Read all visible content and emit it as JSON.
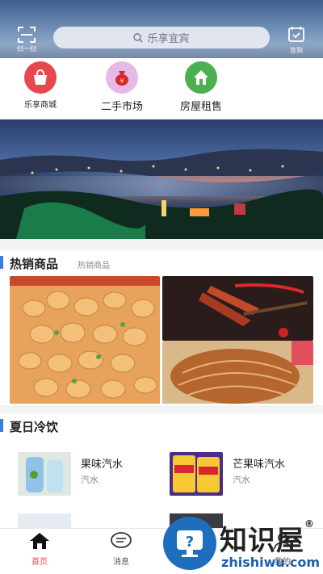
{
  "header": {
    "scan_label": "扫一扫",
    "search_placeholder": "乐享宜宾",
    "checkin_label": "签到"
  },
  "topnav": {
    "items": [
      {
        "label": "乐享商城",
        "icon": "shopping-bag-icon",
        "color": "#e8474d"
      },
      {
        "label": "二手市场",
        "icon": "money-bag-icon",
        "color": "#e6b9e6"
      },
      {
        "label": "房屋租售",
        "icon": "house-icon",
        "color": "#4caf50"
      }
    ]
  },
  "hot": {
    "title": "热销商品",
    "subtitle": "热销商品"
  },
  "summer": {
    "title": "夏日冷饮",
    "items": [
      {
        "name": "果味汽水",
        "category": "汽水"
      },
      {
        "name": "芒果味汽水",
        "category": "汽水"
      }
    ]
  },
  "tabbar": {
    "items": [
      {
        "label": "首页",
        "icon": "home-icon",
        "active": true
      },
      {
        "label": "消息",
        "icon": "message-icon",
        "active": false
      },
      {
        "label": "我的",
        "icon": "user-icon",
        "active": false
      }
    ],
    "active_color": "#e8474d"
  },
  "watermark": {
    "cn": "知识屋",
    "en": "zhishiwu.com"
  }
}
